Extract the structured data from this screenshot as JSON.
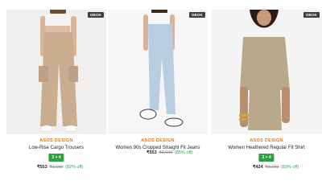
{
  "products": [
    {
      "badge": "OBOK",
      "brand": "ASOS DESIGN",
      "title": "Low-Rise Cargo Trousers",
      "sizes": "3 + 4",
      "price_now": "₹553",
      "price_was": "₹3,150",
      "discount": "(82% off)"
    },
    {
      "badge": "OBOK",
      "brand": "ASOS DESIGN",
      "title": "Women 90s Cropped Straight Fit Jeans",
      "sizes": "",
      "price_now": "₹553",
      "price_was": "₹3,600",
      "discount": "(85% off)"
    },
    {
      "badge": "OBOK",
      "brand": "ASOS DESIGN",
      "title": "Women Heathered Regular Fit Shirt",
      "sizes": "3 + 4",
      "price_now": "₹424",
      "price_was": "₹3,150",
      "discount": "(83% off)"
    }
  ],
  "colors": {
    "brand": "#e0771a",
    "badge_bg": "#3d3d3d",
    "sizes_bg": "#2f9e44",
    "discount": "#2f9e44"
  }
}
